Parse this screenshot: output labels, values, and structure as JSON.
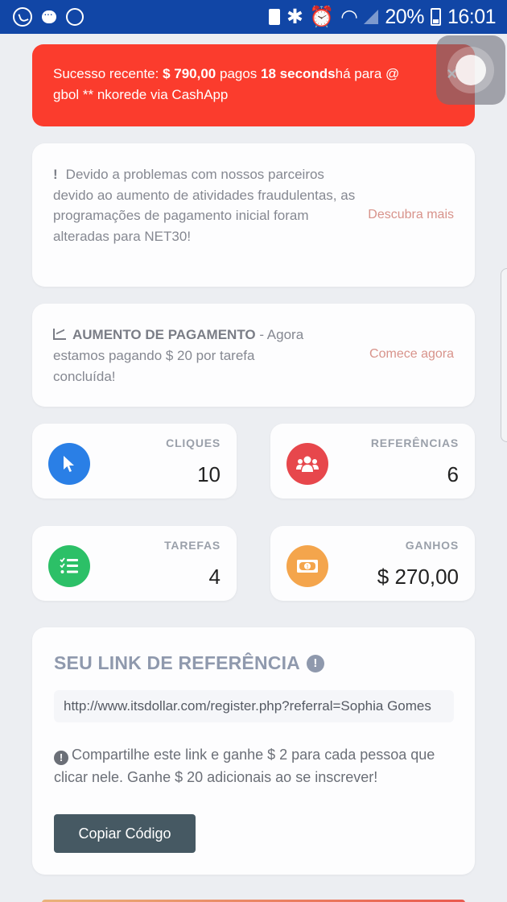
{
  "status_bar": {
    "left_icons": [
      "whatsapp-icon",
      "chat-bubble-icon",
      "circle-icon"
    ],
    "right_icons": [
      "battery-saver-icon",
      "bluetooth-icon",
      "alarm-icon",
      "wifi-icon",
      "signal-icon"
    ],
    "battery": "20%",
    "time": "16:01"
  },
  "toast": {
    "prefix": "Sucesso recente: ",
    "amount": "$ 790,00",
    "mid": " pagos ",
    "time_bold": "18 seconds",
    "suffix": "há para @ gbol ** nkorede via CashApp",
    "close_label": "×",
    "background": "#fb3c2d"
  },
  "notice": {
    "icon": "!",
    "text": "Devido a problemas com nossos parceiros devido ao aumento de atividades fraudulentas, as programações de pagamento inicial foram alteradas para NET30!",
    "link": "Descubra mais"
  },
  "payment_increase": {
    "heading": "AUMENTO DE PAGAMENTO",
    "text": " - Agora estamos pagando $ 20 por tarefa concluída!",
    "link": "Comece agora"
  },
  "stats": [
    {
      "label": "CLIQUES",
      "value": "10",
      "icon": "cursor-icon",
      "color": "#2a7fe6"
    },
    {
      "label": "REFERÊNCIAS",
      "value": "6",
      "icon": "users-icon",
      "color": "#e7474c"
    },
    {
      "label": "TAREFAS",
      "value": "4",
      "icon": "tasks-icon",
      "color": "#2cc067"
    },
    {
      "label": "GANHOS",
      "value": "$ 270,00",
      "icon": "money-icon",
      "color": "#f4a54c"
    }
  ],
  "referral": {
    "title": "SEU LINK DE REFERÊNCIA",
    "url": "http://www.itsdollar.com/register.php?referral=Sophia Gomes",
    "description": "Compartilhe este link e ganhe $ 2 para cada pessoa que clicar nele. Ganhe $ 20 adicionais ao se inscrever!",
    "button": "Copiar Código"
  }
}
